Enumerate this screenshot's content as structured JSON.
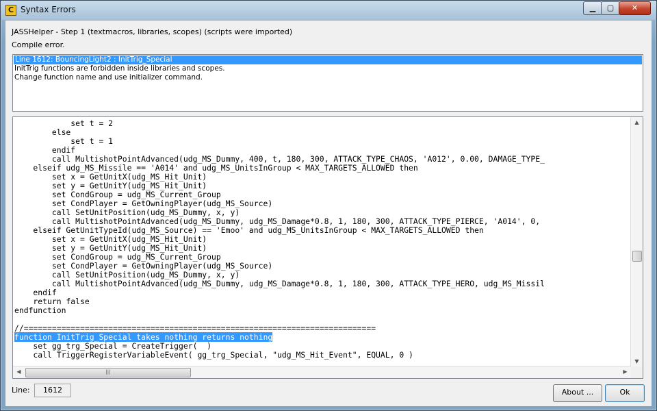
{
  "window": {
    "title": "Syntax Errors",
    "icon_letter": "C"
  },
  "titlebar_buttons": {
    "minimize": "▁",
    "maximize": "▢",
    "close": "✕"
  },
  "info": {
    "step": "JASSHelper - Step 1 (textmacros, libraries, scopes) (scripts were imported)",
    "status": "Compile error."
  },
  "errors": [
    "Line 1612: BouncingLight2 : InitTrig_Special",
    "InitTrig functions are forbidden inside libraries and scopes.",
    "Change function name and use initializer command."
  ],
  "code_lines": [
    "            set t = 2",
    "        else",
    "            set t = 1",
    "        endif",
    "        call MultishotPointAdvanced(udg_MS_Dummy, 400, t, 180, 300, ATTACK_TYPE_CHAOS, 'A012', 0.00, DAMAGE_TYPE_",
    "    elseif udg_MS_Missile == 'A014' and udg_MS_UnitsInGroup < MAX_TARGETS_ALLOWED then",
    "        set x = GetUnitX(udg_MS_Hit_Unit)",
    "        set y = GetUnitY(udg_MS_Hit_Unit)",
    "        set CondGroup = udg_MS_Current_Group",
    "        set CondPlayer = GetOwningPlayer(udg_MS_Source)",
    "        call SetUnitPosition(udg_MS_Dummy, x, y)",
    "        call MultishotPointAdvanced(udg_MS_Dummy, udg_MS_Damage*0.8, 1, 180, 300, ATTACK_TYPE_PIERCE, 'A014', 0,",
    "    elseif GetUnitTypeId(udg_MS_Source) == 'Emoo' and udg_MS_UnitsInGroup < MAX_TARGETS_ALLOWED then",
    "        set x = GetUnitX(udg_MS_Hit_Unit)",
    "        set y = GetUnitY(udg_MS_Hit_Unit)",
    "        set CondGroup = udg_MS_Current_Group",
    "        set CondPlayer = GetOwningPlayer(udg_MS_Source)",
    "        call SetUnitPosition(udg_MS_Dummy, x, y)",
    "        call MultishotPointAdvanced(udg_MS_Dummy, udg_MS_Damage*0.8, 1, 180, 300, ATTACK_TYPE_HERO, udg_MS_Missil",
    "    endif",
    "    return false",
    "endfunction",
    "",
    "//===========================================================================",
    "function InitTrig_Special takes nothing returns nothing",
    "    set gg_trg_Special = CreateTrigger(  )",
    "    call TriggerRegisterVariableEvent( gg_trg_Special, \"udg_MS_Hit_Event\", EQUAL, 0 )"
  ],
  "footer": {
    "line_label": "Line:",
    "line_value": "1612",
    "about_label": "About ...",
    "ok_label": "Ok"
  }
}
